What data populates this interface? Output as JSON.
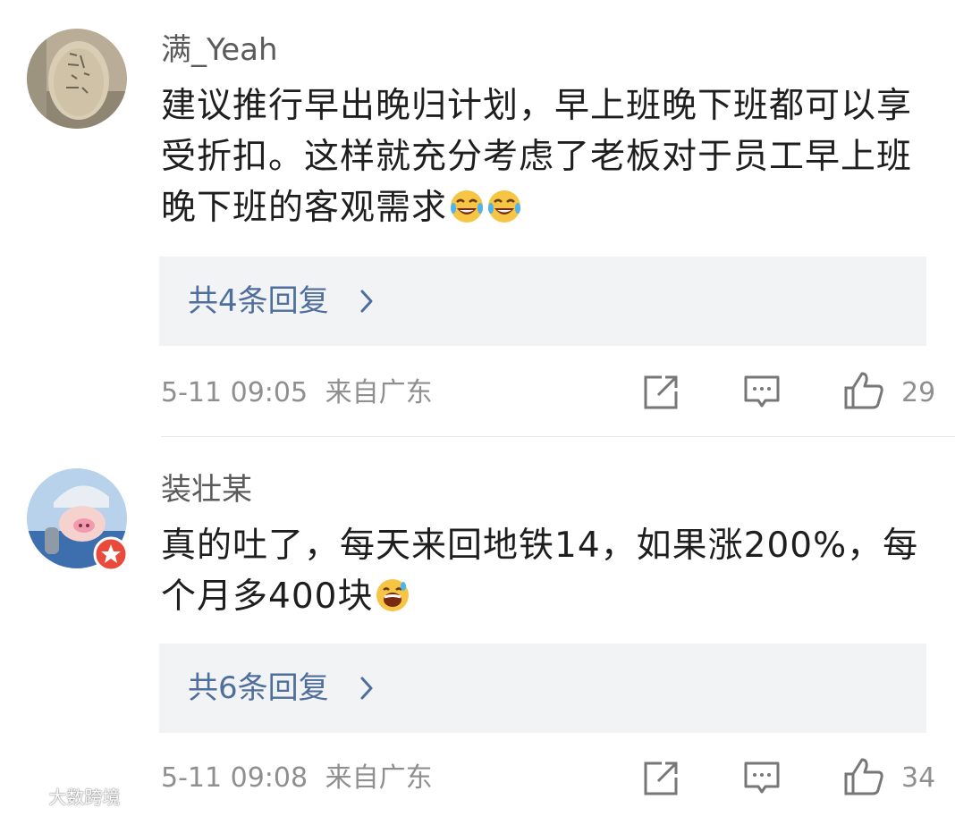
{
  "comments": [
    {
      "username": "满_Yeah",
      "text": "建议推行早出晚归计划，早上班晚下班都可以享受折扣。这样就充分考虑了老板对于员工早上班晚下班的客观需求",
      "emoji": [
        "tears-of-joy-emoji",
        "tears-of-joy-emoji"
      ],
      "replies_label": "共4条回复",
      "time": "5-11 09:05",
      "location": "来自广东",
      "likes": "29"
    },
    {
      "username": "装壮某",
      "text": "真的吐了，每天来回地铁14，如果涨200%，每个月多400块",
      "emoji": [
        "grinning-sweat-emoji"
      ],
      "replies_label": "共6条回复",
      "time": "5-11 09:08",
      "location": "来自广东",
      "likes": "34"
    }
  ],
  "watermark": "大数跨境",
  "colors": {
    "reply_link": "#4e6e9c",
    "reply_bg": "#f2f3f5",
    "meta": "#8f8f8f"
  }
}
